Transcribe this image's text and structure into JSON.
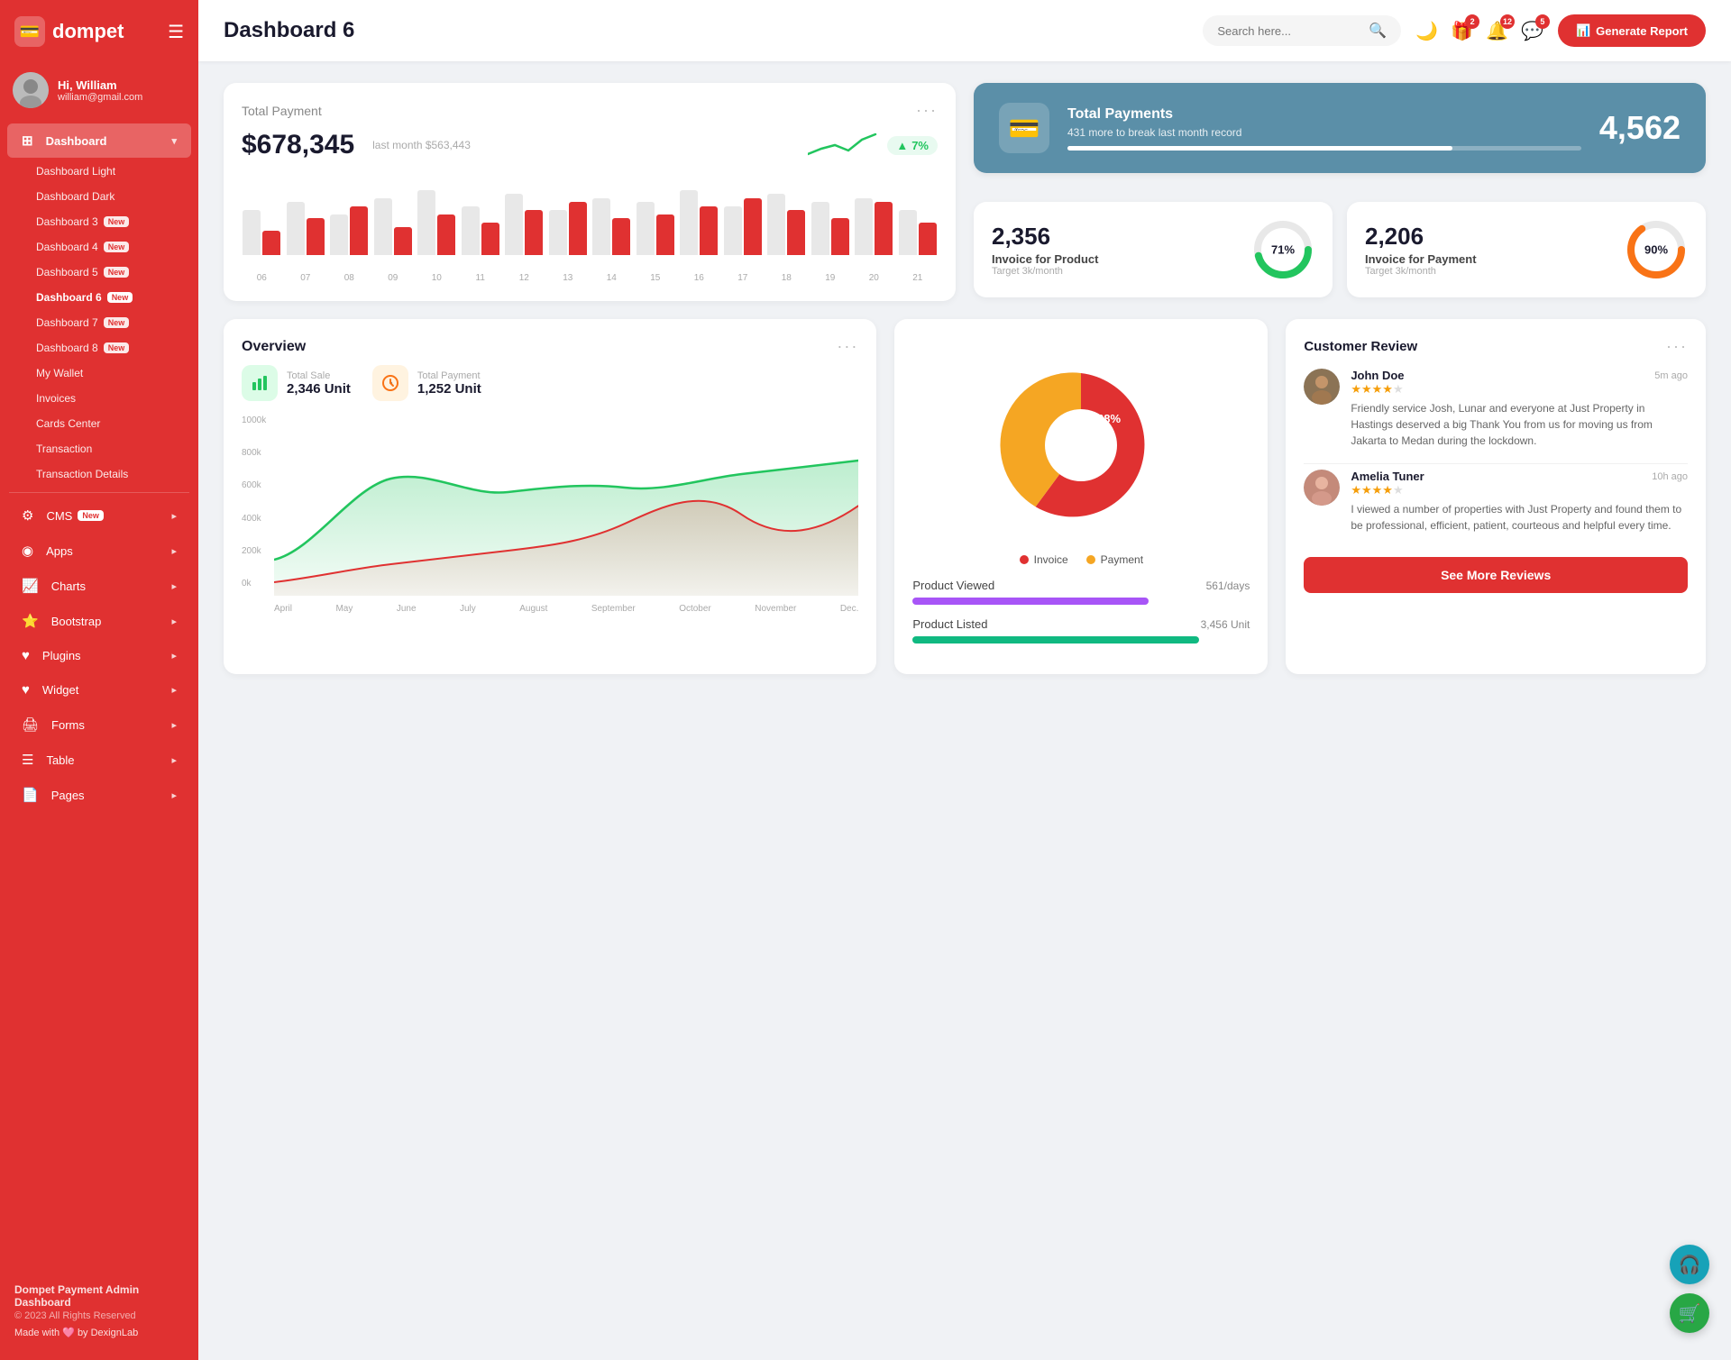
{
  "sidebar": {
    "logo": "dompet",
    "logo_icon": "💳",
    "user": {
      "name": "Hi, William",
      "email": "william@gmail.com",
      "avatar": "👤"
    },
    "nav": [
      {
        "id": "dashboard",
        "label": "Dashboard",
        "icon": "⊞",
        "hasArrow": true,
        "active": true,
        "sub": [
          {
            "label": "Dashboard Light",
            "active": false
          },
          {
            "label": "Dashboard Dark",
            "active": false
          },
          {
            "label": "Dashboard 3",
            "active": false,
            "new": true
          },
          {
            "label": "Dashboard 4",
            "active": false,
            "new": true
          },
          {
            "label": "Dashboard 5",
            "active": false,
            "new": true
          },
          {
            "label": "Dashboard 6",
            "active": true,
            "new": true
          },
          {
            "label": "Dashboard 7",
            "active": false,
            "new": true
          },
          {
            "label": "Dashboard 8",
            "active": false,
            "new": true
          },
          {
            "label": "My Wallet",
            "active": false
          },
          {
            "label": "Invoices",
            "active": false
          },
          {
            "label": "Cards Center",
            "active": false
          },
          {
            "label": "Transaction",
            "active": false
          },
          {
            "label": "Transaction Details",
            "active": false
          }
        ]
      },
      {
        "id": "cms",
        "label": "CMS",
        "icon": "⚙",
        "hasArrow": true,
        "new": true
      },
      {
        "id": "apps",
        "label": "Apps",
        "icon": "◉",
        "hasArrow": true
      },
      {
        "id": "charts",
        "label": "Charts",
        "icon": "📈",
        "hasArrow": true
      },
      {
        "id": "bootstrap",
        "label": "Bootstrap",
        "icon": "⭐",
        "hasArrow": true
      },
      {
        "id": "plugins",
        "label": "Plugins",
        "icon": "♥",
        "hasArrow": true
      },
      {
        "id": "widget",
        "label": "Widget",
        "icon": "♥",
        "hasArrow": true
      },
      {
        "id": "forms",
        "label": "Forms",
        "icon": "🖨",
        "hasArrow": true
      },
      {
        "id": "table",
        "label": "Table",
        "icon": "☰",
        "hasArrow": true
      },
      {
        "id": "pages",
        "label": "Pages",
        "icon": "📄",
        "hasArrow": true
      }
    ],
    "footer": {
      "title": "Dompet Payment Admin Dashboard",
      "copy": "© 2023 All Rights Reserved",
      "made": "Made with 🩷 by DexignLab"
    }
  },
  "topbar": {
    "title": "Dashboard 6",
    "search_placeholder": "Search here...",
    "icons": {
      "theme_toggle": "🌙",
      "gift_badge": 2,
      "bell_badge": 12,
      "chat_badge": 5
    },
    "btn_label": "Generate Report",
    "btn_icon": "📊"
  },
  "total_payment": {
    "title": "Total Payment",
    "amount": "$678,345",
    "last_month": "last month $563,443",
    "trend": "7%",
    "trend_direction": "up",
    "menu": "···",
    "bars": [
      {
        "gray": 55,
        "red": 30,
        "label": "06"
      },
      {
        "gray": 65,
        "red": 45,
        "label": "07"
      },
      {
        "gray": 50,
        "red": 60,
        "label": "08"
      },
      {
        "gray": 70,
        "red": 35,
        "label": "09"
      },
      {
        "gray": 80,
        "red": 50,
        "label": "10"
      },
      {
        "gray": 60,
        "red": 40,
        "label": "11"
      },
      {
        "gray": 75,
        "red": 55,
        "label": "12"
      },
      {
        "gray": 55,
        "red": 65,
        "label": "13"
      },
      {
        "gray": 70,
        "red": 45,
        "label": "14"
      },
      {
        "gray": 65,
        "red": 50,
        "label": "15"
      },
      {
        "gray": 80,
        "red": 60,
        "label": "16"
      },
      {
        "gray": 60,
        "red": 70,
        "label": "17"
      },
      {
        "gray": 75,
        "red": 55,
        "label": "18"
      },
      {
        "gray": 65,
        "red": 45,
        "label": "19"
      },
      {
        "gray": 70,
        "red": 65,
        "label": "20"
      },
      {
        "gray": 55,
        "red": 40,
        "label": "21"
      }
    ]
  },
  "total_payments_blue": {
    "title": "Total Payments",
    "sub": "431 more to break last month record",
    "number": "4,562",
    "progress": 75,
    "icon": "💳"
  },
  "invoice_product": {
    "number": "2,356",
    "label": "Invoice for Product",
    "target": "Target 3k/month",
    "percent": 71,
    "color": "#22c55e"
  },
  "invoice_payment": {
    "number": "2,206",
    "label": "Invoice for Payment",
    "target": "Target 3k/month",
    "percent": 90,
    "color": "#f97316"
  },
  "overview": {
    "title": "Overview",
    "menu": "···",
    "total_sale_label": "Total Sale",
    "total_sale_value": "2,346 Unit",
    "total_payment_label": "Total Payment",
    "total_payment_value": "1,252 Unit",
    "months": [
      "April",
      "May",
      "June",
      "July",
      "August",
      "September",
      "October",
      "November",
      "Dec."
    ],
    "y_labels": [
      "1000k",
      "800k",
      "600k",
      "400k",
      "200k",
      "0k"
    ]
  },
  "pie_chart": {
    "invoice_pct": 62,
    "payment_pct": 38,
    "invoice_color": "#e03131",
    "payment_color": "#f5a623",
    "legend_invoice": "Invoice",
    "legend_payment": "Payment"
  },
  "product_stats": {
    "viewed_label": "Product Viewed",
    "viewed_value": "561/days",
    "viewed_color": "#a855f7",
    "listed_label": "Product Listed",
    "listed_value": "3,456 Unit",
    "listed_color": "#10b981"
  },
  "customer_review": {
    "title": "Customer Review",
    "menu": "···",
    "reviews": [
      {
        "name": "John Doe",
        "time": "5m ago",
        "stars": 4,
        "text": "Friendly service Josh, Lunar and everyone at Just Property in Hastings deserved a big Thank You from us for moving us from Jakarta to Medan during the lockdown.",
        "avatar": "👨"
      },
      {
        "name": "Amelia Tuner",
        "time": "10h ago",
        "stars": 4,
        "text": "I viewed a number of properties with Just Property and found them to be professional, efficient, patient, courteous and helpful every time.",
        "avatar": "👩"
      }
    ],
    "see_more_label": "See More Reviews"
  },
  "fab": {
    "support_icon": "🎧",
    "cart_icon": "🛒"
  }
}
